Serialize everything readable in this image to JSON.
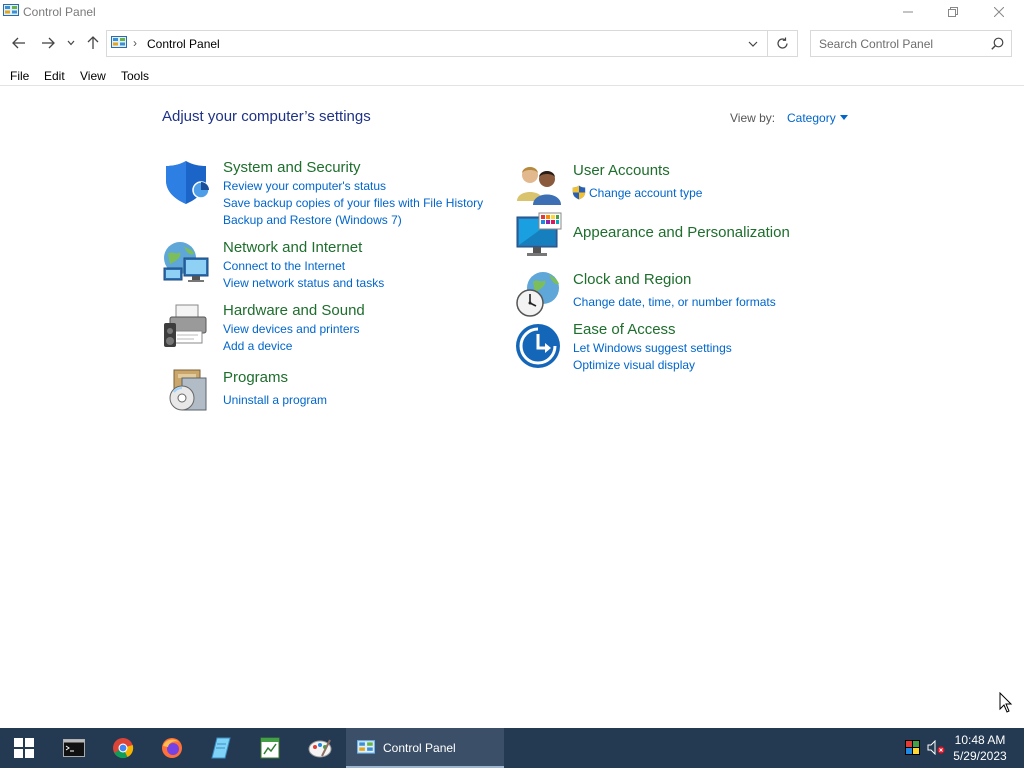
{
  "window": {
    "title": "Control Panel"
  },
  "address": {
    "separator": "›",
    "path": "Control Panel"
  },
  "search": {
    "placeholder": "Search Control Panel"
  },
  "menu": [
    "File",
    "Edit",
    "View",
    "Tools"
  ],
  "main": {
    "heading": "Adjust your computer’s settings",
    "view_by_label": "View by:",
    "view_by_value": "Category"
  },
  "categories": [
    {
      "title": "System and Security",
      "icon": "shield-icon",
      "links": [
        "Review your computer's status",
        "Save backup copies of your files with File History",
        "Backup and Restore (Windows 7)"
      ]
    },
    {
      "title": "Network and Internet",
      "icon": "network-globe-icon",
      "links": [
        "Connect to the Internet",
        "View network status and tasks"
      ]
    },
    {
      "title": "Hardware and Sound",
      "icon": "printer-speaker-icon",
      "links": [
        "View devices and printers",
        "Add a device"
      ]
    },
    {
      "title": "Programs",
      "icon": "programs-disc-icon",
      "links": [
        "Uninstall a program"
      ]
    },
    {
      "title": "User Accounts",
      "icon": "users-icon",
      "links": [
        "Change account type"
      ]
    },
    {
      "title": "Appearance and Personalization",
      "icon": "monitor-palette-icon",
      "links": []
    },
    {
      "title": "Clock and Region",
      "icon": "clock-globe-icon",
      "links": [
        "Change date, time, or number formats"
      ]
    },
    {
      "title": "Ease of Access",
      "icon": "ease-of-access-icon",
      "links": [
        "Let Windows suggest settings",
        "Optimize visual display"
      ]
    }
  ],
  "taskbar": {
    "active_window_label": "Control Panel",
    "time": "10:48 AM",
    "date": "5/29/2023",
    "apps": [
      "windows-start-icon",
      "terminal-icon",
      "chrome-icon",
      "firefox-icon",
      "notepad-icon",
      "spreadsheet-icon",
      "paint-icon"
    ]
  },
  "colors": {
    "heading": "#1e3287",
    "category_title": "#1e6e2d",
    "link": "#0066cc",
    "taskbar": "#243a53"
  }
}
